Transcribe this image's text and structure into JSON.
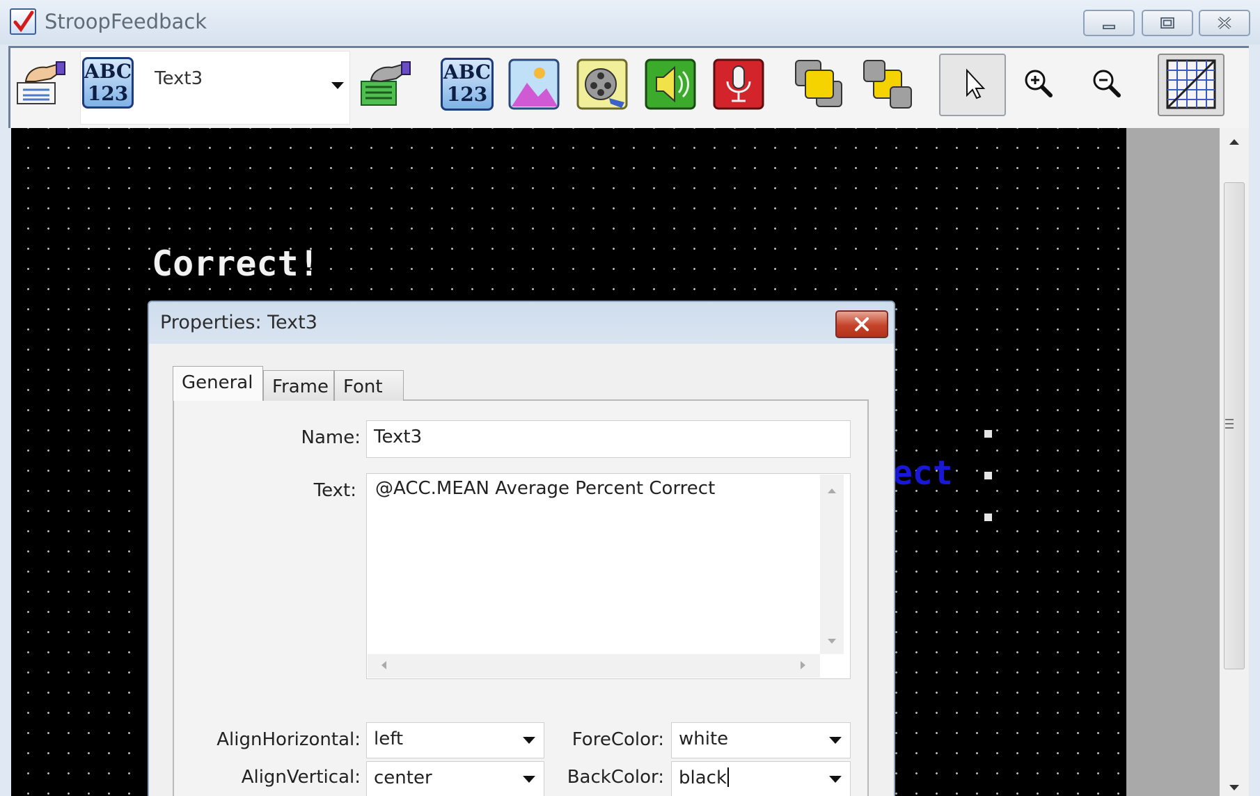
{
  "window": {
    "title": "StroopFeedback"
  },
  "toolbar": {
    "object_selector_value": "Text3",
    "abc_label_top": "ABC",
    "abc_label_bottom": "123"
  },
  "canvas": {
    "correct_text": "Correct!",
    "partial_blue_text": "ect"
  },
  "dialog": {
    "title": "Properties: Text3",
    "tabs": [
      {
        "label": "General"
      },
      {
        "label": "Frame"
      },
      {
        "label": "Font"
      }
    ],
    "fields": {
      "name_label": "Name:",
      "name_value": "Text3",
      "text_label": "Text:",
      "text_value": "@ACC.MEAN Average Percent Correct",
      "align_h_label": "AlignHorizontal:",
      "align_h_value": "left",
      "align_v_label": "AlignVertical:",
      "align_v_value": "center",
      "forecolor_label": "ForeColor:",
      "forecolor_value": "white",
      "backcolor_label": "BackColor:",
      "backcolor_value": "black"
    }
  },
  "colors": {
    "canvas_bg": "#000000",
    "blue_text": "#1a18d8",
    "close_button": "#c5432a",
    "titlebar": "#dfe8f3"
  }
}
